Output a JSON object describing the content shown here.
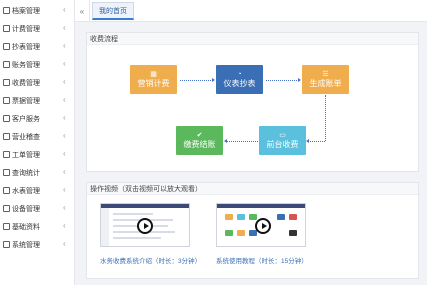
{
  "sidebar": {
    "items": [
      {
        "label": "档案管理",
        "icon": "folder-icon"
      },
      {
        "label": "计费管理",
        "icon": "billing-icon"
      },
      {
        "label": "抄表管理",
        "icon": "meter-icon"
      },
      {
        "label": "账务管理",
        "icon": "ledger-icon"
      },
      {
        "label": "收费管理",
        "icon": "cashier-icon"
      },
      {
        "label": "票据管理",
        "icon": "invoice-icon"
      },
      {
        "label": "客户服务",
        "icon": "service-icon"
      },
      {
        "label": "营业稽查",
        "icon": "audit-icon"
      },
      {
        "label": "工单管理",
        "icon": "workorder-icon"
      },
      {
        "label": "查询统计",
        "icon": "report-icon"
      },
      {
        "label": "水表管理",
        "icon": "watermeter-icon"
      },
      {
        "label": "设备管理",
        "icon": "device-icon"
      },
      {
        "label": "基础资料",
        "icon": "database-icon"
      },
      {
        "label": "系统管理",
        "icon": "settings-icon"
      }
    ]
  },
  "tabbar": {
    "active_tab": "我的首页"
  },
  "flow": {
    "title": "收费流程",
    "steps": [
      {
        "label": "营销计费",
        "icon": "calculator-icon",
        "color": "#f0ad4e"
      },
      {
        "label": "仪表抄表",
        "icon": "gauge-icon",
        "color": "#3a6fb5"
      },
      {
        "label": "生成账单",
        "icon": "list-icon",
        "color": "#f0ad4e"
      },
      {
        "label": "前台收费",
        "icon": "card-icon",
        "color": "#5bc0de"
      },
      {
        "label": "缴费结账",
        "icon": "check-icon",
        "color": "#5cb85c"
      }
    ]
  },
  "videos": {
    "title": "操作视频（双击视频可以放大观看）",
    "items": [
      {
        "caption": "水务收费系统介绍（时长：3分钟）"
      },
      {
        "caption": "系统使用教程（时长：15分钟）"
      }
    ]
  }
}
